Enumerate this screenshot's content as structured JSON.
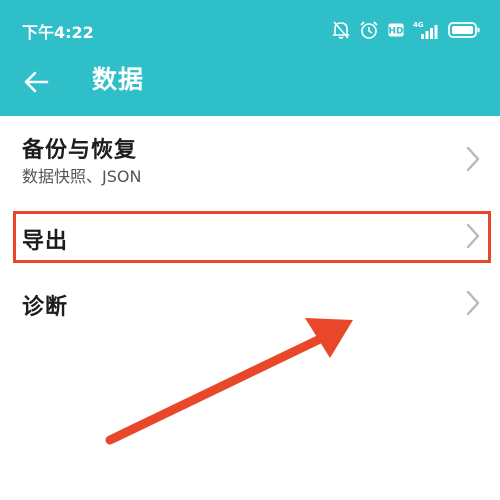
{
  "status_bar": {
    "time": "下午4:22",
    "icons": [
      "bell-off-icon",
      "alarm-icon",
      "hd-icon",
      "signal-4g-icon",
      "battery-icon"
    ],
    "network_label": "4G",
    "hd_label": "HD"
  },
  "app_bar": {
    "title": "数据",
    "back_icon": "arrow-left-icon",
    "color": "#2fbfc8"
  },
  "settings": {
    "items": [
      {
        "title": "备份与恢复",
        "subtitle": "数据快照、JSON",
        "icon": "chevron-right-icon"
      },
      {
        "title": "导出",
        "icon": "chevron-right-icon"
      },
      {
        "title": "诊断",
        "icon": "chevron-right-icon"
      }
    ]
  },
  "annotation": {
    "highlight_color": "#e8472a",
    "highlighted_item": "导出"
  }
}
